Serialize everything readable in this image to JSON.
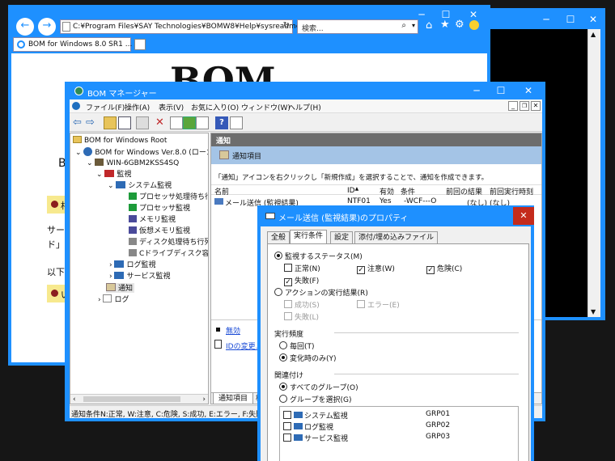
{
  "browser": {
    "address": "C:¥Program Files¥SAY Technologies¥BOMW8¥Help¥sysreadme.",
    "search_placeholder": "検索...",
    "tab_title": "BOM for Windows 8.0 SR1 ...",
    "page_logo": "BOM",
    "page_fragments": {
      "b": "B",
      "bullet1": "相",
      "line1": "サー",
      "line2": "ド」に",
      "line3": "以下",
      "bullet2": "い"
    }
  },
  "bom": {
    "title": "BOM マネージャー",
    "menu": [
      "ファイル(F)",
      "操作(A)",
      "表示(V)",
      "お気に入り(O)",
      "ウィンドウ(W)",
      "ヘルプ(H)"
    ],
    "tree": {
      "root": "BOM for Windows Root",
      "local": "BOM for Windows Ver.8.0 (ローカル)",
      "host": "WIN-6GBM2KSS4SQ",
      "monitor": "監視",
      "system": "システム監視",
      "proc_wait": "プロセッサ処理待ち行",
      "proc": "プロセッサ監視",
      "mem": "メモリ監視",
      "vmem": "仮想メモリ監視",
      "disk_wait": "ディスク処理待ち行列",
      "cdrive": "Cドライブディスク容量",
      "log_mon": "ログ監視",
      "service_mon": "サービス監視",
      "notify": "通知",
      "log": "ログ"
    },
    "right": {
      "header": "通知",
      "subheader": "通知項目",
      "hint": "「通知」アイコンを右クリックし「新規作成」を選択することで、通知を作成できます。",
      "columns": [
        "名前",
        "ID",
        "有効",
        "条件",
        "前回の結果",
        "前回実行時刻"
      ],
      "row": {
        "name": "メール送信 (監視結果)",
        "id": "NTF01",
        "enabled": "Yes",
        "condition": "-WCF---O",
        "last_result": "(なし)",
        "last_time": "(なし)"
      },
      "link1": "無効",
      "link2": "IDの変更..."
    },
    "bottom_tabs": [
      "通知項目",
      "標"
    ],
    "status": "通知条件N:正常, W:注意, C:危険, S:成功, E:エラー, F:失敗, O:不"
  },
  "dialog": {
    "title": "メール送信 (監視結果)のプロパティ",
    "tabs": [
      "全般",
      "実行条件",
      "設定",
      "添付/埋め込みファイル"
    ],
    "status_radio": "監視するステータス(M)",
    "normal": "正常(N)",
    "warning": "注意(W)",
    "danger": "危険(C)",
    "fail": "失敗(F)",
    "action_radio": "アクションの実行結果(R)",
    "success": "成功(S)",
    "error": "エラー(E)",
    "failure": "失敗(L)",
    "freq_label": "実行頻度",
    "every": "毎回(T)",
    "on_change": "変化時のみ(Y)",
    "assoc_label": "関連付け",
    "all_groups": "すべてのグループ(O)",
    "select_groups": "グループを選択(G)",
    "groups": [
      {
        "name": "システム監視",
        "id": "GRP01"
      },
      {
        "name": "ログ監視",
        "id": "GRP02"
      },
      {
        "name": "サービス監視",
        "id": "GRP03"
      }
    ]
  },
  "colors": {
    "accent": "#1e90ff",
    "dialog_close": "#c42b1c",
    "header_bar": "#6d6d6d",
    "subheader_bar": "#a4c4e6"
  }
}
